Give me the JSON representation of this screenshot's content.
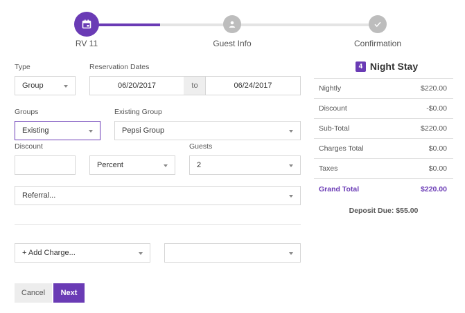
{
  "stepper": {
    "steps": [
      {
        "label": "RV 11",
        "icon": "calendar-icon",
        "state": "active"
      },
      {
        "label": "Guest Info",
        "icon": "person-icon",
        "state": "inactive"
      },
      {
        "label": "Confirmation",
        "icon": "check-icon",
        "state": "inactive"
      }
    ],
    "colors": {
      "active": "#6a3bb5",
      "inactive": "#bdbdbd"
    }
  },
  "form": {
    "type": {
      "label": "Type",
      "value": "Group"
    },
    "dates": {
      "label": "Reservation Dates",
      "start": "06/20/2017",
      "separator": "to",
      "end": "06/24/2017"
    },
    "groups": {
      "label": "Groups",
      "value": "Existing"
    },
    "existing_group": {
      "label": "Existing Group",
      "value": "Pepsi Group"
    },
    "discount": {
      "label": "Discount",
      "value": "",
      "unit": "Percent"
    },
    "guests": {
      "label": "Guests",
      "value": "2"
    },
    "referral": {
      "value": "Referral..."
    },
    "add_charge": {
      "value": "+ Add Charge...",
      "secondary_value": ""
    }
  },
  "buttons": {
    "cancel": "Cancel",
    "next": "Next"
  },
  "summary": {
    "nights": "4",
    "nights_label": "Night Stay",
    "rows": [
      {
        "label": "Nightly",
        "value": "$220.00"
      },
      {
        "label": "Discount",
        "value": "-$0.00"
      },
      {
        "label": "Sub-Total",
        "value": "$220.00"
      },
      {
        "label": "Charges Total",
        "value": "$0.00"
      },
      {
        "label": "Taxes",
        "value": "$0.00"
      }
    ],
    "grand_total": {
      "label": "Grand Total",
      "value": "$220.00"
    },
    "deposit": "Deposit Due: $55.00"
  },
  "theme": {
    "accent": "#6a3bb5"
  }
}
